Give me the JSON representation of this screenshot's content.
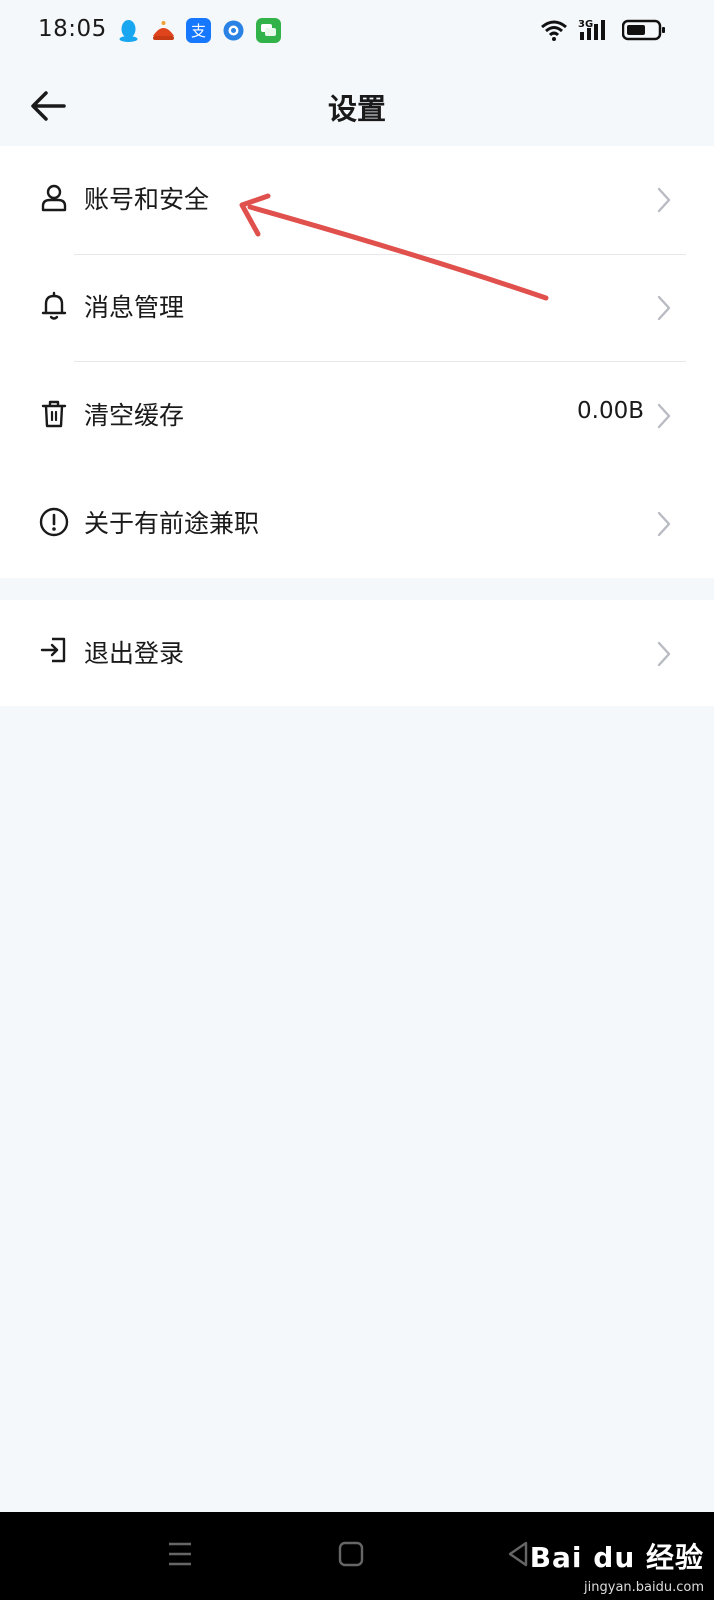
{
  "status_bar": {
    "time": "18:05",
    "notification_icons": [
      "qq-icon",
      "taobao-icon",
      "alipay-icon",
      "browser-icon",
      "message-icon"
    ],
    "network": "3G",
    "system_icons": [
      "wifi-icon",
      "cellular-signal-icon",
      "battery-icon"
    ]
  },
  "header": {
    "title": "设置",
    "back_icon": "back-arrow-icon"
  },
  "settings_group_1": [
    {
      "label": "账号和安全",
      "icon": "user-icon",
      "value": ""
    },
    {
      "label": "消息管理",
      "icon": "bell-icon",
      "value": ""
    },
    {
      "label": "清空缓存",
      "icon": "trash-icon",
      "value": "0.00B"
    },
    {
      "label": "关于有前途兼职",
      "icon": "info-circle-icon",
      "value": ""
    }
  ],
  "settings_group_2": [
    {
      "label": "退出登录",
      "icon": "logout-icon",
      "value": ""
    }
  ],
  "nav_bar": {
    "buttons": [
      "menu-icon",
      "home-icon",
      "back-triangle-icon"
    ]
  },
  "watermark": {
    "brand": "Bai du 经验",
    "url": "jingyan.baidu.com"
  },
  "colors": {
    "background": "#f5f8fa",
    "card": "#ffffff",
    "annotation_arrow": "#e0504d",
    "chevron": "#b8bcc2"
  }
}
